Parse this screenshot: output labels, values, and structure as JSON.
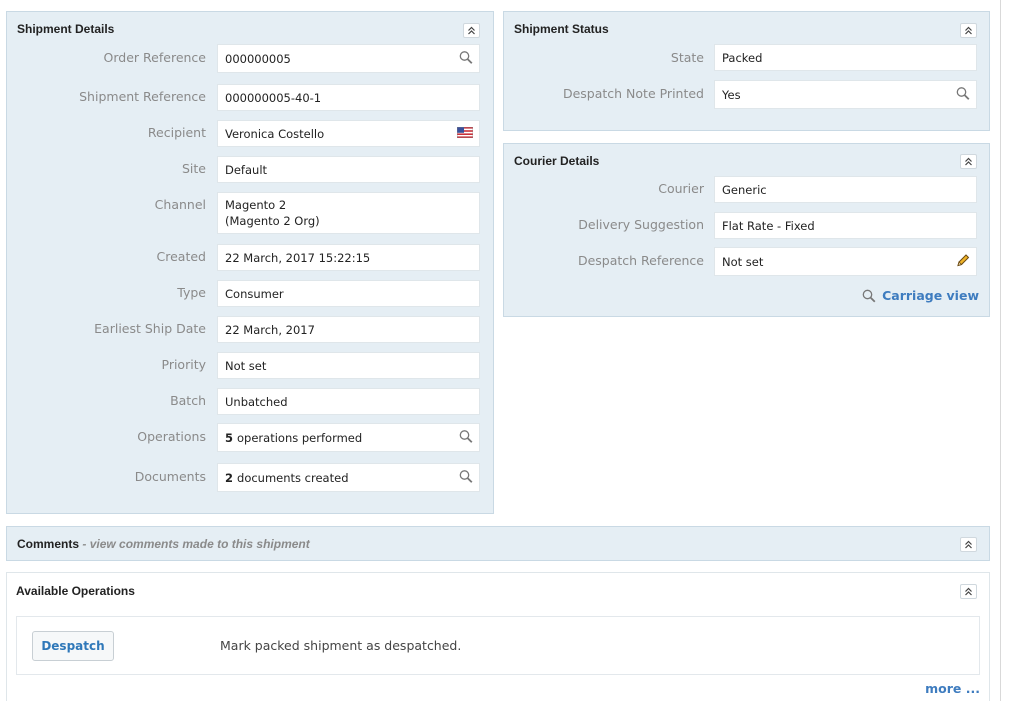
{
  "shipment_details": {
    "title": "Shipment Details",
    "fields": {
      "order_reference": {
        "label": "Order Reference",
        "value": "000000005"
      },
      "shipment_reference": {
        "label": "Shipment Reference",
        "value": "000000005-40-1"
      },
      "recipient": {
        "label": "Recipient",
        "value": "Veronica Costello"
      },
      "site": {
        "label": "Site",
        "value": "Default"
      },
      "channel": {
        "label": "Channel",
        "value_line1": "Magento 2",
        "value_line2": "(Magento 2 Org)"
      },
      "created": {
        "label": "Created",
        "value": "22 March, 2017 15:22:15"
      },
      "type": {
        "label": "Type",
        "value": "Consumer"
      },
      "earliest_ship_date": {
        "label": "Earliest Ship Date",
        "value": "22 March, 2017"
      },
      "priority": {
        "label": "Priority",
        "value": "Not set"
      },
      "batch": {
        "label": "Batch",
        "value": "Unbatched"
      },
      "operations": {
        "label": "Operations",
        "count": "5",
        "value": "operations performed"
      },
      "documents": {
        "label": "Documents",
        "count": "2",
        "value": "documents created"
      }
    }
  },
  "shipment_status": {
    "title": "Shipment Status",
    "fields": {
      "state": {
        "label": "State",
        "value": "Packed"
      },
      "despatch_note_printed": {
        "label": "Despatch Note Printed",
        "value": "Yes"
      }
    }
  },
  "courier_details": {
    "title": "Courier Details",
    "fields": {
      "courier": {
        "label": "Courier",
        "value": "Generic"
      },
      "delivery_suggestion": {
        "label": "Delivery Suggestion",
        "value": "Flat Rate - Fixed"
      },
      "despatch_reference": {
        "label": "Despatch Reference",
        "value": "Not set"
      }
    },
    "carriage_view_label": "Carriage view"
  },
  "comments": {
    "title": "Comments",
    "subtitle": "- view comments made to this shipment"
  },
  "available_operations": {
    "title": "Available Operations",
    "despatch_button": "Despatch",
    "despatch_description": "Mark packed shipment as despatched.",
    "more_link": "more ..."
  },
  "colors": {
    "panel_bg": "#e5eef4",
    "link": "#3e7cbf",
    "label": "#8a8a8a"
  }
}
